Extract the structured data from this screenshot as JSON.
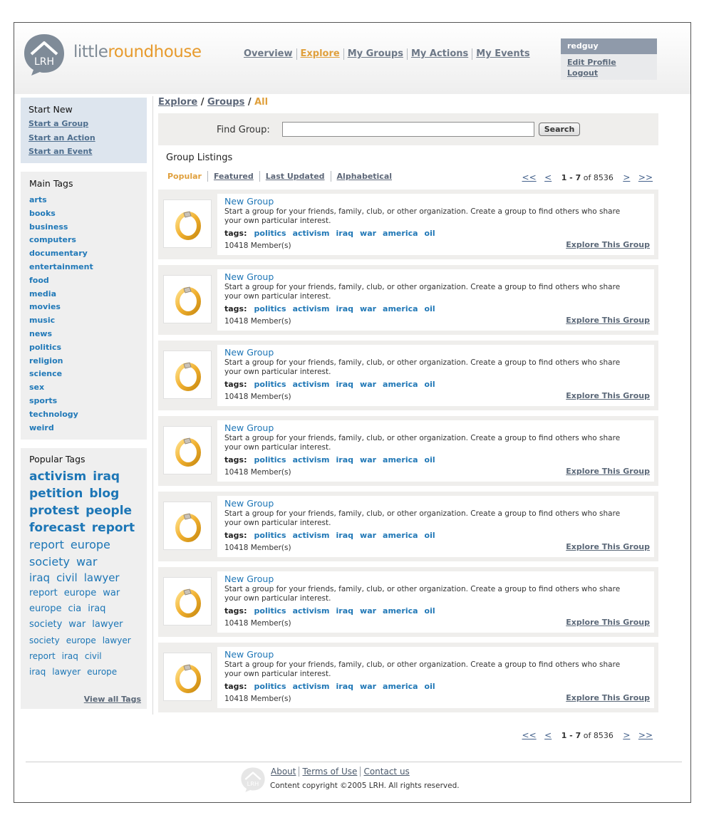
{
  "brand": {
    "name_part1": "little",
    "name_part2": "roundhouse",
    "mark_text": "LRH"
  },
  "topnav": [
    "Overview",
    "Explore",
    "My Groups",
    "My Actions",
    "My Events"
  ],
  "user": {
    "name": "redguy",
    "edit_profile": "Edit Profile",
    "logout": "Logout"
  },
  "start_new": {
    "title": "Start New",
    "links": [
      "Start a Group",
      "Start an Action",
      "Start an Event"
    ]
  },
  "main_tags": {
    "title": "Main Tags",
    "items": [
      "arts",
      "books",
      "business",
      "computers",
      "documentary",
      "entertainment",
      "food",
      "media",
      "movies",
      "music",
      "news",
      "politics",
      "religion",
      "science",
      "sex",
      "sports",
      "technology",
      "weird"
    ]
  },
  "popular_tags": {
    "title": "Popular Tags",
    "lines": [
      [
        "activism",
        "iraq"
      ],
      [
        "petition",
        "blog"
      ],
      [
        "protest",
        "people"
      ],
      [
        "forecast",
        "report"
      ],
      [
        "report",
        "europe"
      ],
      [
        "society",
        "war"
      ],
      [
        "iraq",
        "civil",
        "lawyer"
      ],
      [
        "report",
        "europe",
        "war"
      ],
      [
        "europe",
        "cia",
        "iraq"
      ],
      [
        "society",
        "war",
        "lawyer"
      ],
      [
        "society",
        "europe",
        "lawyer"
      ],
      [
        "report",
        "iraq",
        "civil"
      ],
      [
        "iraq",
        "lawyer",
        "europe"
      ]
    ],
    "view_all": "View all Tags"
  },
  "breadcrumb": {
    "explore": "Explore",
    "sep": "/",
    "groups": "Groups",
    "current": "All"
  },
  "search": {
    "label": "Find Group:",
    "value": "",
    "button": "Search"
  },
  "listing": {
    "title": "Group Listings",
    "sorts": [
      "Popular",
      "Featured",
      "Last Updated",
      "Alphabetical"
    ],
    "pager": {
      "first": "<<",
      "prev": "<",
      "range": "1 - 7",
      "of": "of 8536",
      "next": ">",
      "last": ">>"
    }
  },
  "groups": [
    {
      "title": "New Group",
      "description": "Start a group for your friends, family, club, or other organization. Create a group to find others who share your own particular interest.",
      "tags_label": "tags:",
      "tags": [
        "politics",
        "activism",
        "iraq",
        "war",
        "america",
        "oil"
      ],
      "members": "10418 Member(s)",
      "explore": "Explore This Group"
    },
    {
      "title": "New Group",
      "description": "Start a group for your friends, family, club, or other organization. Create a group to find others who share your own particular interest.",
      "tags_label": "tags:",
      "tags": [
        "politics",
        "activism",
        "iraq",
        "war",
        "america",
        "oil"
      ],
      "members": "10418 Member(s)",
      "explore": "Explore This Group"
    },
    {
      "title": "New Group",
      "description": "Start a group for your friends, family, club, or other organization. Create a group to find others who share your own particular interest.",
      "tags_label": "tags:",
      "tags": [
        "politics",
        "activism",
        "iraq",
        "war",
        "america",
        "oil"
      ],
      "members": "10418 Member(s)",
      "explore": "Explore This Group"
    },
    {
      "title": "New Group",
      "description": "Start a group for your friends, family, club, or other organization. Create a group to find others who share your own particular interest.",
      "tags_label": "tags:",
      "tags": [
        "politics",
        "activism",
        "iraq",
        "war",
        "america",
        "oil"
      ],
      "members": "10418 Member(s)",
      "explore": "Explore This Group"
    },
    {
      "title": "New Group",
      "description": "Start a group for your friends, family, club, or other organization. Create a group to find others who share your own particular interest.",
      "tags_label": "tags:",
      "tags": [
        "politics",
        "activism",
        "iraq",
        "war",
        "america",
        "oil"
      ],
      "members": "10418 Member(s)",
      "explore": "Explore This Group"
    },
    {
      "title": "New Group",
      "description": "Start a group for your friends, family, club, or other organization. Create a group to find others who share your own particular interest.",
      "tags_label": "tags:",
      "tags": [
        "politics",
        "activism",
        "iraq",
        "war",
        "america",
        "oil"
      ],
      "members": "10418 Member(s)",
      "explore": "Explore This Group"
    },
    {
      "title": "New Group",
      "description": "Start a group for your friends, family, club, or other organization. Create a group to find others who share your own particular interest.",
      "tags_label": "tags:",
      "tags": [
        "politics",
        "activism",
        "iraq",
        "war",
        "america",
        "oil"
      ],
      "members": "10418 Member(s)",
      "explore": "Explore This Group"
    }
  ],
  "footer": {
    "links": [
      "About",
      "Terms of Use",
      "Contact us"
    ],
    "copyright": "Content copyright ©2005 LRH. All rights reserved."
  },
  "colors": {
    "accent": "#e0a03d",
    "link": "#1f77b6",
    "nav": "#6d7887",
    "panel": "#efeeec",
    "startnew_bg": "#dde5ee"
  },
  "icons": {
    "logo": "house-speech-bubble-icon",
    "group_thumb": "ring-icon"
  }
}
